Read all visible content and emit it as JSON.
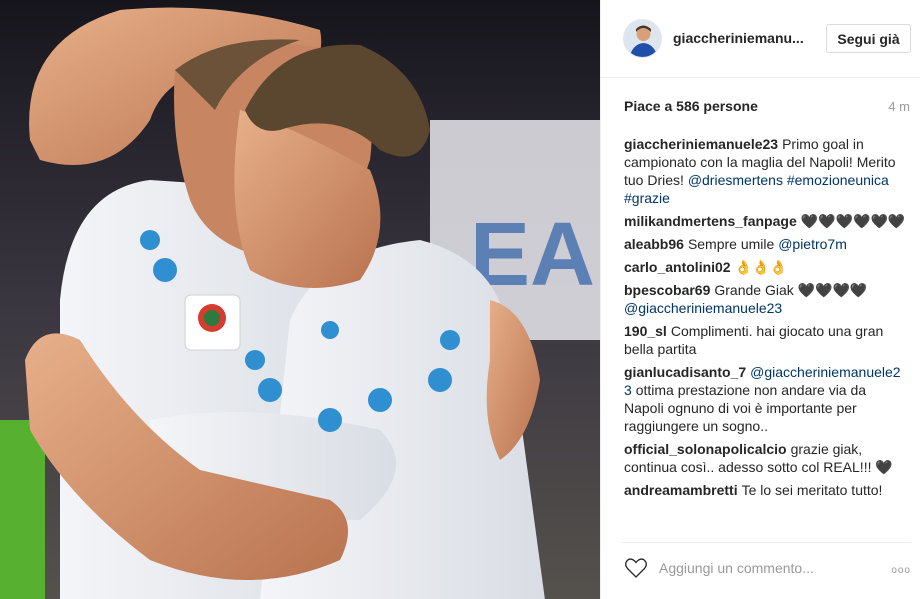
{
  "post": {
    "username": "giaccheriniemanu...",
    "follow_label": "Segui già",
    "likes": "Piace a 586 persone",
    "time": "4 m",
    "comment_placeholder": "Aggiungi un commento...",
    "more_label": "ooo"
  },
  "comments": [
    {
      "user": "giaccheriniemanuele23",
      "text": "Primo goal in campionato con la maglia del Napoli! Merito tuo Dries!",
      "link": "@driesmertens #emozioneunica #grazie"
    },
    {
      "user": "milikandmertens_fanpage",
      "text": "🖤🖤🖤🖤🖤🖤",
      "link": ""
    },
    {
      "user": "aleabb96",
      "text": "Sempre umile",
      "link": "@pietro7m"
    },
    {
      "user": "carlo_antolini02",
      "text": "👌👌👌",
      "link": ""
    },
    {
      "user": "bpescobar69",
      "text": "Grande Giak 🖤🖤🖤🖤",
      "link": "@giaccheriniemanuele23"
    },
    {
      "user": "190_sl",
      "text": "Complimenti. hai giocato una gran bella partita",
      "link": ""
    },
    {
      "user": "gianlucadisanto_7",
      "text": "",
      "link": "@giaccheriniemanuele23",
      "text_after": "ottima prestazione non andare via da Napoli ognuno di voi è importante per raggiungere un sogno.."
    },
    {
      "user": "official_solonapolicalcio",
      "text": "grazie giak, continua così.. adesso sotto col REAL!!! 🖤",
      "link": ""
    },
    {
      "user": "andreamambretti",
      "text": "Te lo sei meritato tutto!",
      "link": ""
    }
  ],
  "colors": {
    "link": "#003569",
    "border": "#efefef",
    "kappa_blue": "#2f8fd0"
  }
}
